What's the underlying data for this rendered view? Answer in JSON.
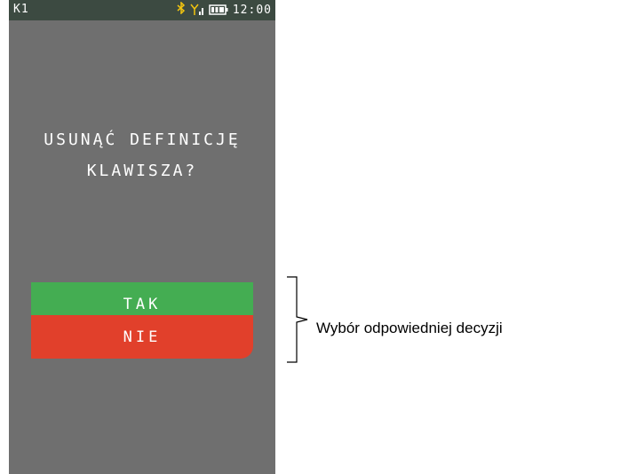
{
  "status_bar": {
    "window_label": "K1",
    "bluetooth_icon": "bluetooth-icon",
    "signal_icon": "signal-icon",
    "battery_icon": "battery-icon",
    "time": "12:00"
  },
  "dialog": {
    "question_line1": "USUNĄĆ DEFINICJĘ",
    "question_line2": "KLAWISZA?"
  },
  "buttons": {
    "yes_label": "TAK",
    "no_label": "NIE",
    "yes_color": "#44ad52",
    "no_color": "#e1402b"
  },
  "annotation": {
    "text": "Wybór odpowiedniej decyzji"
  },
  "colors": {
    "screen_background": "#6f6f6f",
    "status_bar_background": "#3c4a41",
    "bluetooth_accent": "#f1c40f"
  }
}
